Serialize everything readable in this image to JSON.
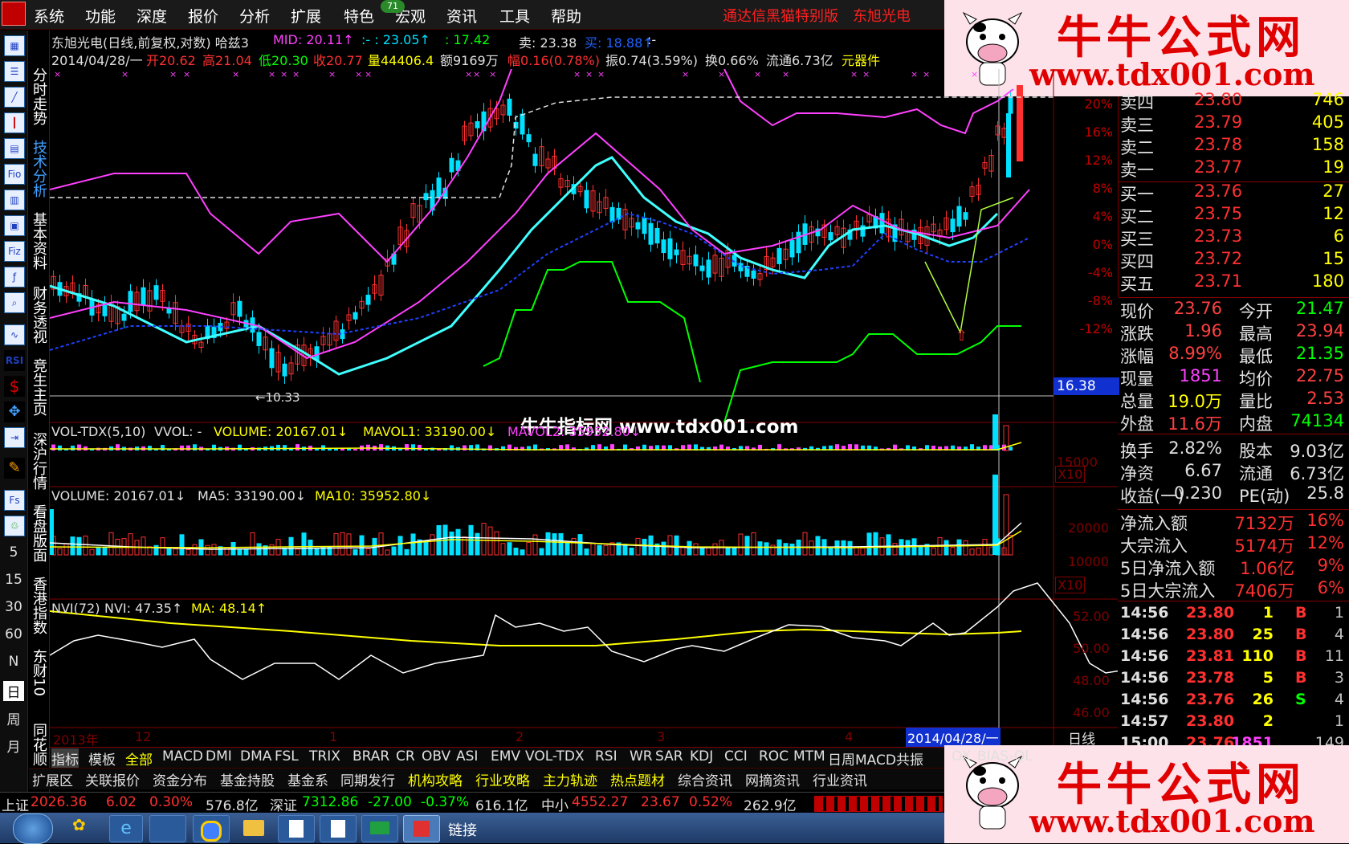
{
  "menu": {
    "items": [
      "系统",
      "功能",
      "深度",
      "报价",
      "分析",
      "扩展",
      "特色",
      "宏观",
      "资讯",
      "工具",
      "帮助"
    ],
    "badge": "71",
    "edition": "通达信黑猫特别版",
    "stock_name": "东旭光电"
  },
  "banner": {
    "site_name": "牛牛公式网",
    "site_url": "www.tdx001.com"
  },
  "watermark": "牛牛指标网 www.tdx001.com",
  "left_toolbar": {
    "icons": [
      "chart-line-icon",
      "list-icon",
      "trend-icon",
      "candle-icon",
      "table-icon",
      "fio-icon",
      "grid-icon",
      "finance-icon",
      "fiz-icon",
      "fx-icon",
      "search-icon",
      "wave-icon",
      "rsi-icon",
      "dollar-icon",
      "move-icon",
      "export-icon",
      "pencil-icon",
      "fs-icon",
      "recycle-icon"
    ],
    "fio_label": "Fio",
    "fiz_label": "Fiz",
    "rsi_label": "RSI",
    "periods": [
      "5",
      "15",
      "30",
      "60",
      "N",
      "日",
      "周",
      "月"
    ]
  },
  "vertical_tabs": [
    "分时走势",
    "技术分析",
    "基本资料",
    "财务透视",
    "竞生主页",
    "深沪行情",
    "看盘版面",
    "香港指数",
    "东财10",
    "同花顺10"
  ],
  "chart_header": {
    "line1": {
      "title": "东旭光电(日线,前复权,对数) 哈兹3",
      "mid": "MID: 20.11↑",
      "a": ":- : 23.05↑",
      "b": ": 17.42",
      "sell": "卖: 23.38",
      "buy": "买: 18.88↑",
      "tail": ":-"
    },
    "line2": {
      "date": "2014/04/28/一",
      "open": "开20.62",
      "high": "高21.04",
      "low": "低20.30",
      "close": "收20.77",
      "vol": "量44406.4",
      "amount": "额9169万",
      "change": "幅0.16(0.78%)",
      "amp": "振0.74(3.59%)",
      "turnover": "换0.66%",
      "float": "流通6.73亿",
      "sector": "元器件"
    }
  },
  "price_axis": [
    "20%",
    "16%",
    "12%",
    "8%",
    "4%",
    "0%",
    "-4%",
    "-8%",
    "-12%"
  ],
  "price_tag": "16.38",
  "low_label": "←10.33",
  "vol_panel": {
    "label": "VOL-TDX(5,10)",
    "vvol": "VVOL: -",
    "volume": "VOLUME: 20167.01↓",
    "mavol1": "MAVOL1: 33190.00↓",
    "mavol2": "MAVOL2: 35952.80↓",
    "axis": "15000",
    "x10": "X10"
  },
  "volume_panel": {
    "volume": "VOLUME: 20167.01↓",
    "ma5": "MA5: 33190.00↓",
    "ma10": "MA10: 35952.80↓",
    "axis": [
      "20000",
      "10000"
    ],
    "x10": "X10"
  },
  "nvi_panel": {
    "label": "NVI(72)",
    "nvi": "NVI: 47.35↑",
    "ma": "MA: 48.14↑",
    "axis": [
      "52.00",
      "50.00",
      "48.00",
      "46.00"
    ]
  },
  "date_axis": {
    "labels": [
      "2013年",
      "12",
      "1",
      "2",
      "3",
      "4"
    ],
    "current": "2014/04/28/一",
    "period": "日线"
  },
  "order_book": {
    "sells": [
      {
        "label": "卖四",
        "price": "23.80",
        "vol": "746"
      },
      {
        "label": "卖三",
        "price": "23.79",
        "vol": "405"
      },
      {
        "label": "卖二",
        "price": "23.78",
        "vol": "158"
      },
      {
        "label": "卖一",
        "price": "23.77",
        "vol": "19"
      }
    ],
    "buys": [
      {
        "label": "买一",
        "price": "23.76",
        "vol": "27"
      },
      {
        "label": "买二",
        "price": "23.75",
        "vol": "12"
      },
      {
        "label": "买三",
        "price": "23.73",
        "vol": "6"
      },
      {
        "label": "买四",
        "price": "23.72",
        "vol": "15"
      },
      {
        "label": "买五",
        "price": "23.71",
        "vol": "180"
      }
    ]
  },
  "quote": [
    {
      "l": "现价",
      "v": "23.76",
      "l2": "今开",
      "v2": "21.47",
      "c1": "#ff4040",
      "c2": "#00ff00"
    },
    {
      "l": "涨跌",
      "v": "1.96",
      "l2": "最高",
      "v2": "23.94",
      "c1": "#ff4040",
      "c2": "#ff4040"
    },
    {
      "l": "涨幅",
      "v": "8.99%",
      "l2": "最低",
      "v2": "21.35",
      "c1": "#ff4040",
      "c2": "#00ff00"
    },
    {
      "l": "现量",
      "v": "1851",
      "l2": "均价",
      "v2": "22.75",
      "c1": "#ff40ff",
      "c2": "#ff4040"
    },
    {
      "l": "总量",
      "v": "19.0万",
      "l2": "量比",
      "v2": "2.53",
      "c1": "#ffff00",
      "c2": "#ff4040"
    },
    {
      "l": "外盘",
      "v": "11.6万",
      "l2": "内盘",
      "v2": "74134",
      "c1": "#ff4040",
      "c2": "#00ff00"
    }
  ],
  "fundamentals": [
    {
      "l": "换手",
      "v": "2.82%",
      "l2": "股本",
      "v2": "9.03亿"
    },
    {
      "l": "净资",
      "v": "6.67",
      "l2": "流通",
      "v2": "6.73亿"
    },
    {
      "l": "收益(一)",
      "v": "0.230",
      "l2": "PE(动)",
      "v2": "25.8"
    }
  ],
  "capital_flow": [
    {
      "l": "净流入额",
      "v": "7132万",
      "p": "16%"
    },
    {
      "l": "大宗流入",
      "v": "5174万",
      "p": "12%"
    },
    {
      "l": "5日净流入额",
      "v": "1.06亿",
      "p": "9%"
    },
    {
      "l": "5日大宗流入",
      "v": "7406万",
      "p": "6%"
    }
  ],
  "ticks": [
    {
      "t": "14:56",
      "p": "23.80",
      "v": "1",
      "s": "B",
      "n": "1"
    },
    {
      "t": "14:56",
      "p": "23.80",
      "v": "25",
      "s": "B",
      "n": "4"
    },
    {
      "t": "14:56",
      "p": "23.81",
      "v": "110",
      "s": "B",
      "n": "11"
    },
    {
      "t": "14:56",
      "p": "23.78",
      "v": "5",
      "s": "B",
      "n": "3"
    },
    {
      "t": "14:56",
      "p": "23.76",
      "v": "26",
      "s": "S",
      "n": "4"
    },
    {
      "t": "14:57",
      "p": "23.80",
      "v": "2",
      "s": "",
      "n": "1"
    },
    {
      "t": "15:00",
      "p": "23.76",
      "v": "1851",
      "s": "",
      "n": "149"
    }
  ],
  "indicator_tabs": [
    "指标",
    "模板",
    "全部",
    "MACD",
    "DMI",
    "DMA",
    "FSL",
    "TRIX",
    "BRAR",
    "CR",
    "OBV",
    "ASI",
    "EMV",
    "VOL-TDX",
    "RSI",
    "WR",
    "SAR",
    "KDJ",
    "CCI",
    "ROC",
    "MTM",
    "日周MACD共振",
    "OX",
    "BIAS-QL"
  ],
  "info_tabs": [
    "扩展区",
    "关联报价",
    "资金分布",
    "基金持股",
    "基金系",
    "同期发行",
    "机构攻略",
    "行业攻略",
    "主力轨迹",
    "热点题材",
    "综合资讯",
    "网摘资讯",
    "行业资讯"
  ],
  "status_bar": {
    "sh_label": "上证",
    "sh_value": "2026.36",
    "sh_change": "6.02",
    "sh_pct": "0.30%",
    "sh_amount": "576.8亿",
    "sz_label": "深证",
    "sz_value": "7312.86",
    "sz_change": "-27.00",
    "sz_pct": "-0.37%",
    "sz_amount": "616.1亿",
    "zx_label": "中小",
    "zx_value": "4552.27",
    "zx_change": "23.67",
    "zx_pct": "0.52%",
    "zx_amount": "262.9亿"
  },
  "taskbar": {
    "links_label": "链接"
  },
  "colors": {
    "up": "#ff3030",
    "down": "#00e0ff",
    "ma_cyan": "#40ffff",
    "magenta": "#ff40ff",
    "green": "#00ff00",
    "yellow": "#ffff00"
  }
}
